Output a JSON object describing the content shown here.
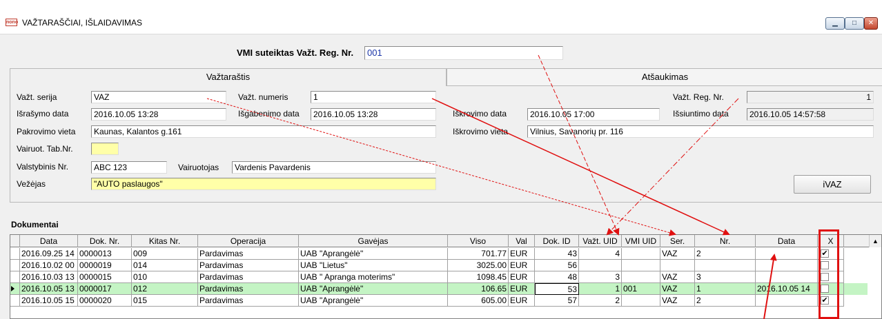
{
  "window": {
    "title": "VAŽTARAŠČIAI, IŠLAIDAVIMAS",
    "app_icon_text": "nono",
    "controls": {
      "minimize": "▁",
      "maximize": "□",
      "close": "✕"
    }
  },
  "reg": {
    "label": "VMI suteiktas Važt. Reg. Nr.",
    "value": "001"
  },
  "tabs": {
    "vaztarastis": "Važtaraštis",
    "atsaukimas": "Atšaukimas"
  },
  "form": {
    "serija_label": "Važt. serija",
    "serija": "VAZ",
    "numeris_label": "Važt. numeris",
    "numeris": "1",
    "israsymo_label": "Išrašymo data",
    "israsymo": "2016.10.05 13:28",
    "isgabenimo_label": "Išgabenimo data",
    "isgabenimo": "2016.10.05 13:28",
    "pakrovimo_label": "Pakrovimo vieta",
    "pakrovimo": "Kaunas, Kalantos  g.161",
    "tabnr_label": "Vairuot. Tab.Nr.",
    "tabnr": "",
    "valst_label": "Valstybinis Nr.",
    "valst": "ABC 123",
    "vairuotojas_label": "Vairuotojas",
    "vairuotojas": "Vardenis Pavardenis",
    "vezejas_label": "Vežėjas",
    "vezejas": "\"AUTO paslaugos\"",
    "iskrovimo_data_label": "Iškrovimo data",
    "iskrovimo_data": "2016.10.05 17:00",
    "iskrovimo_vieta_label": "Iškrovimo vieta",
    "iskrovimo_vieta": "Vilnius, Savanorių pr. 116",
    "vazt_reg_label": "Važt. Reg. Nr.",
    "vazt_reg": "1",
    "issiuntimo_label": "Išsiuntimo data",
    "issiuntimo": "2016.10.05 14:57:58",
    "ivaz_button": "iVAZ"
  },
  "documents": {
    "label": "Dokumentai",
    "columns": [
      "Data",
      "Dok. Nr.",
      "Kitas Nr.",
      "Operacija",
      "Gavėjas",
      "Viso",
      "Val",
      "Dok. ID",
      "Važt. UID",
      "VMI UID",
      "Ser.",
      "Nr.",
      "Data",
      "X"
    ],
    "rows": [
      {
        "data": "2016.09.25 14",
        "dok_nr": "0000013",
        "kitas_nr": "009",
        "operacija": "Pardavimas",
        "gavejas": "UAB \"Aprangėlė\"",
        "viso": "701.77",
        "val": "EUR",
        "dok_id": "43",
        "vazt_uid": "4",
        "vmi_uid": "",
        "ser": "VAZ",
        "nr": "2",
        "data2": "",
        "x": "✔",
        "selected": false
      },
      {
        "data": "2016.10.02 00",
        "dok_nr": "0000019",
        "kitas_nr": "014",
        "operacija": "Pardavimas",
        "gavejas": "UAB \"Lietus\"",
        "viso": "3025.00",
        "val": "EUR",
        "dok_id": "56",
        "vazt_uid": "",
        "vmi_uid": "",
        "ser": "",
        "nr": "",
        "data2": "",
        "x": "",
        "selected": false
      },
      {
        "data": "2016.10.03 13",
        "dok_nr": "0000015",
        "kitas_nr": "010",
        "operacija": "Pardavimas",
        "gavejas": "UAB \" Apranga moterims\"",
        "viso": "1098.45",
        "val": "EUR",
        "dok_id": "48",
        "vazt_uid": "3",
        "vmi_uid": "",
        "ser": "VAZ",
        "nr": "3",
        "data2": "",
        "x": "",
        "selected": false
      },
      {
        "data": "2016.10.05 13",
        "dok_nr": "0000017",
        "kitas_nr": "012",
        "operacija": "Pardavimas",
        "gavejas": "UAB \"Aprangėlė\"",
        "viso": "106.65",
        "val": "EUR",
        "dok_id": "53",
        "vazt_uid": "1",
        "vmi_uid": "001",
        "ser": "VAZ",
        "nr": "1",
        "data2": "2016.10.05 14",
        "x": "",
        "selected": true
      },
      {
        "data": "2016.10.05 15",
        "dok_nr": "0000020",
        "kitas_nr": "015",
        "operacija": "Pardavimas",
        "gavejas": "UAB \"Aprangėlė\"",
        "viso": "605.00",
        "val": "EUR",
        "dok_id": "57",
        "vazt_uid": "2",
        "vmi_uid": "",
        "ser": "VAZ",
        "nr": "2",
        "data2": "",
        "x": "✔",
        "selected": false
      }
    ]
  },
  "scroll_up": "▲",
  "annotation_color": "#e01010"
}
